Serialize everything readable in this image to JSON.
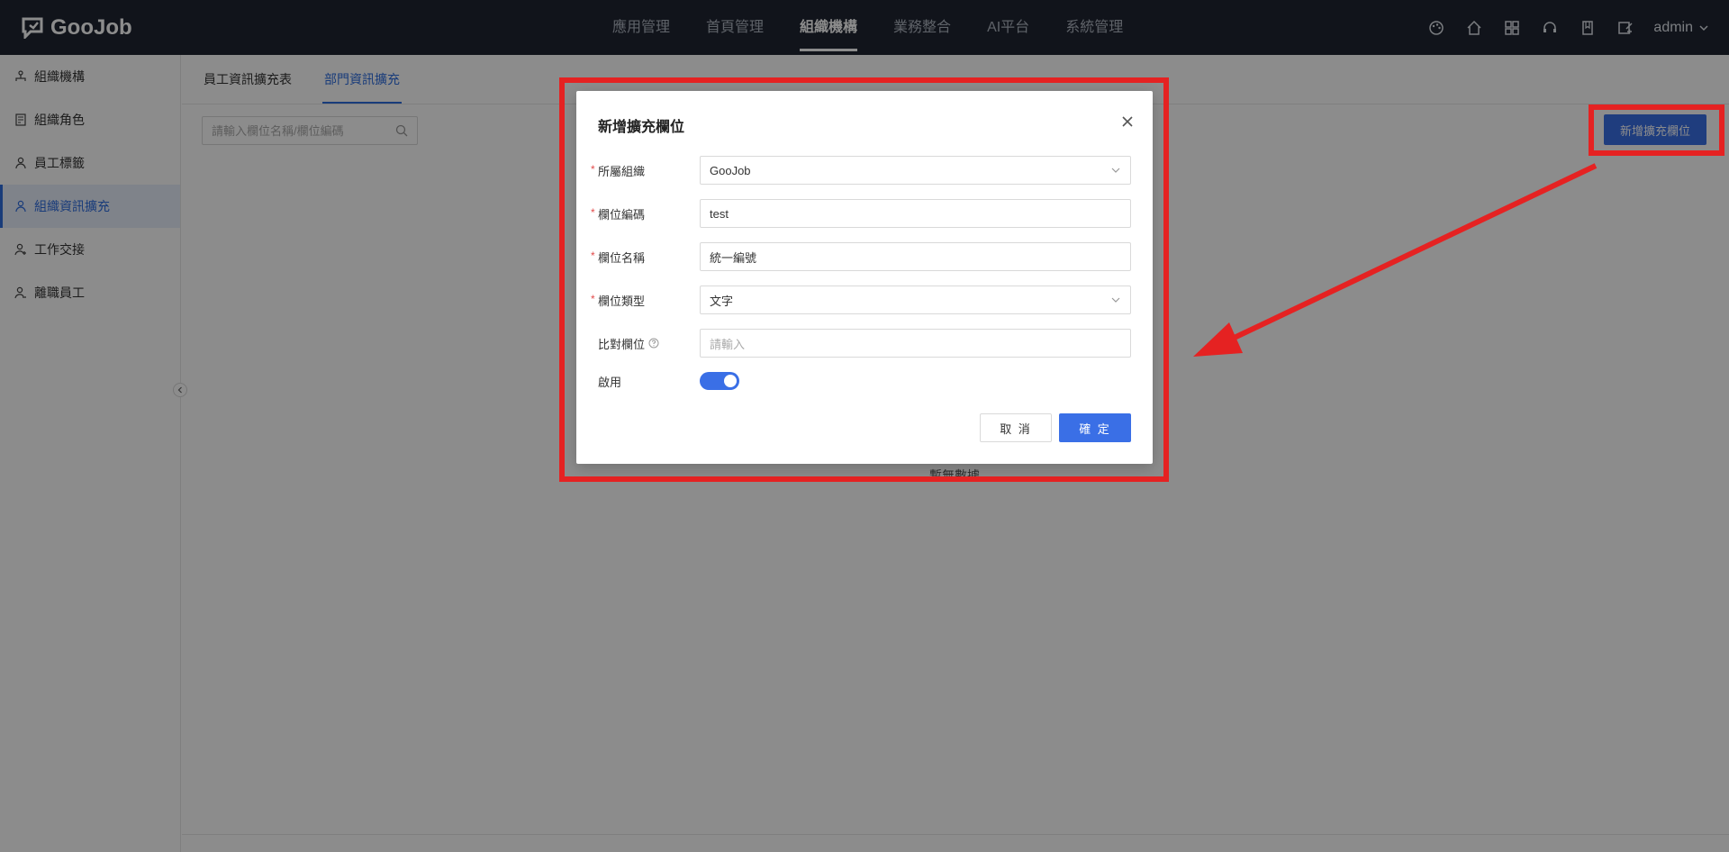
{
  "brand": {
    "name": "GooJob"
  },
  "topnav": {
    "items": [
      {
        "label": "應用管理",
        "active": false
      },
      {
        "label": "首頁管理",
        "active": false
      },
      {
        "label": "組織機構",
        "active": true
      },
      {
        "label": "業務整合",
        "active": false
      },
      {
        "label": "AI平台",
        "active": false
      },
      {
        "label": "系統管理",
        "active": false
      }
    ],
    "icons": [
      "palette-icon",
      "home-icon",
      "grid-icon",
      "headset-icon",
      "book-icon",
      "edit-icon"
    ],
    "user": "admin"
  },
  "sidebar": {
    "items": [
      {
        "label": "組織機構",
        "icon": "org-icon",
        "active": false
      },
      {
        "label": "組織角色",
        "icon": "doc-icon",
        "active": false
      },
      {
        "label": "員工標籤",
        "icon": "user-icon",
        "active": false
      },
      {
        "label": "組織資訊擴充",
        "icon": "user-icon",
        "active": true
      },
      {
        "label": "工作交接",
        "icon": "user-add-icon",
        "active": false
      },
      {
        "label": "離職員工",
        "icon": "user-leave-icon",
        "active": false
      }
    ]
  },
  "main": {
    "tabs": [
      {
        "label": "員工資訊擴充表",
        "active": false
      },
      {
        "label": "部門資訊擴充",
        "active": true
      }
    ],
    "search_placeholder": "請輸入欄位名稱/欄位編碼",
    "add_button": "新增擴充欄位",
    "empty_text": "暫無數據"
  },
  "modal": {
    "title": "新增擴充欄位",
    "fields": {
      "org": {
        "label": "所屬組織",
        "required": true,
        "value": "GooJob",
        "type": "select"
      },
      "code": {
        "label": "欄位編碼",
        "required": true,
        "value": "test",
        "type": "input"
      },
      "name": {
        "label": "欄位名稱",
        "required": true,
        "value": "統一編號",
        "type": "input"
      },
      "field_type": {
        "label": "欄位類型",
        "required": true,
        "value": "文字",
        "type": "select"
      },
      "compare": {
        "label": "比對欄位",
        "required": false,
        "value": "",
        "placeholder": "請輸入",
        "type": "input"
      },
      "enabled": {
        "label": "啟用",
        "required": false,
        "on": true,
        "type": "toggle"
      }
    },
    "cancel_label": "取 消",
    "ok_label": "確 定"
  },
  "colors": {
    "primary": "#3a6fe6",
    "topbar": "#1f2532",
    "annotation": "#e52222"
  }
}
